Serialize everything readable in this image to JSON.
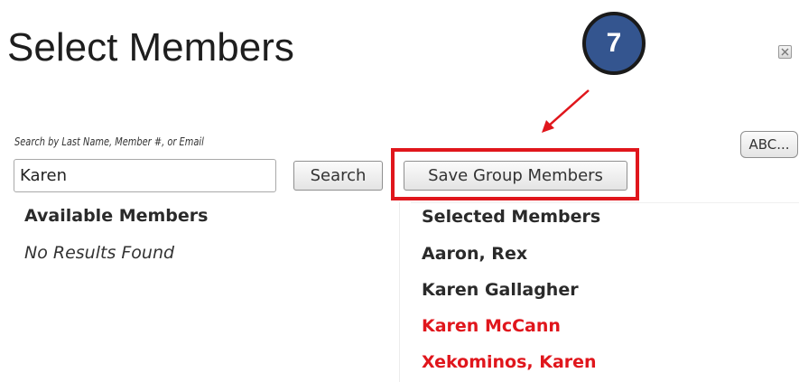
{
  "dialog": {
    "title": "Select Members"
  },
  "annotation": {
    "step_number": "7",
    "highlight_color": "#e0161c",
    "badge_color": "#34558f"
  },
  "search": {
    "hint": "Search by Last Name, Member #, or Email",
    "value": "Karen",
    "search_label": "Search",
    "save_label": "Save Group Members",
    "abc_label": "ABC..."
  },
  "available": {
    "heading": "Available Members",
    "empty_text": "No Results Found"
  },
  "selected": {
    "heading": "Selected Members",
    "members": [
      {
        "name": "Aaron, Rex",
        "color": "#2a2a2a"
      },
      {
        "name": "Karen Gallagher",
        "color": "#2a2a2a"
      },
      {
        "name": "Karen McCann",
        "color": "#e0161c"
      },
      {
        "name": "Xekominos, Karen",
        "color": "#e0161c"
      }
    ]
  },
  "icons": {
    "close": "close-icon",
    "arrow": "annotation-arrow-icon"
  }
}
